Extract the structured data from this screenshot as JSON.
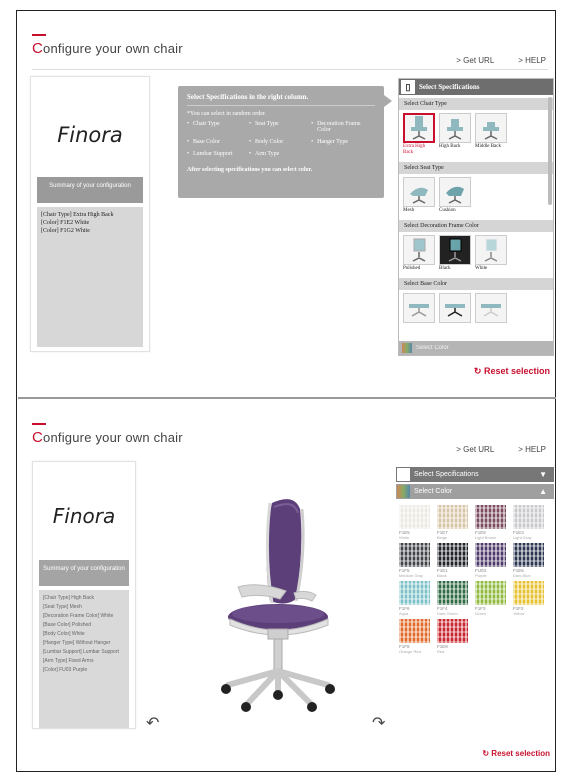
{
  "panel1": {
    "title_cap": "C",
    "title_rest": "onfigure your own chair",
    "links": {
      "get_url": "> Get URL",
      "help": "> HELP"
    },
    "brand": "Finora",
    "summary_header": "Summary of your configuration",
    "summary_lines": [
      "[Chair Type] Extra High Back",
      "[Color] F1E2 White",
      "[Color] F1G2 White"
    ],
    "instructions": {
      "title": "Select Specifications in the right column.",
      "note": "*You can select in random order.",
      "items": [
        "Chair Type",
        "Seat Type",
        "Decoration Frame Color",
        "Base Color",
        "Body Color",
        "Hanger Type",
        "Lumbar Support",
        "Arm Type"
      ],
      "after": "After selecting specifications you can select color."
    },
    "spec_panel": {
      "header": "Select Specifications",
      "sections": [
        {
          "label": "Select Chair Type",
          "options": [
            "Extra High Back",
            "High Back",
            "Middle Back"
          ]
        },
        {
          "label": "Select Seat Type",
          "options": [
            "Mesh",
            "Cushion"
          ]
        },
        {
          "label": "Select Decoration Frame Color",
          "options": [
            "Polished",
            "Black",
            "White"
          ]
        },
        {
          "label": "Select Base Color",
          "options": [
            "",
            "",
            ""
          ]
        }
      ],
      "footer": "Select Color"
    },
    "reset": "Reset selection"
  },
  "panel2": {
    "title_cap": "C",
    "title_rest": "onfigure your own chair",
    "links": {
      "get_url": "> Get URL",
      "help": "> HELP"
    },
    "brand": "Finora",
    "summary_header": "Summary of your configuration",
    "summary_lines": [
      "[Chair Type] High Back",
      "[Seat Type] Mesh",
      "[Decoration Frame Color] White",
      "[Base Color] Polished",
      "[Body Color] White",
      "[Hanger Type] Without Hanger",
      "[Lumbar Support] Lumbar Support",
      "[Arm Type] Fixed Arms",
      "[Color] FU03 Purple"
    ],
    "spec_header": "Select Specifications",
    "color_header": "Select Color",
    "swatches": [
      {
        "code": "F1E5",
        "name": "White",
        "color": "#ece9e2"
      },
      {
        "code": "F1E7",
        "name": "Beige",
        "color": "#d8c6a8"
      },
      {
        "code": "F1E8",
        "name": "Light Brown",
        "color": "#7a4a5e"
      },
      {
        "code": "F1E3",
        "name": "Light Gray",
        "color": "#c9c9cc"
      },
      {
        "code": "F1F5",
        "name": "Medium Gray",
        "color": "#404448"
      },
      {
        "code": "F1E1",
        "name": "Black",
        "color": "#1f2226"
      },
      {
        "code": "FU03",
        "name": "Purple",
        "color": "#4e3a6a"
      },
      {
        "code": "F1E6",
        "name": "Dark Blue",
        "color": "#2b3550"
      },
      {
        "code": "F1F6",
        "name": "Aqua",
        "color": "#7bc1c7"
      },
      {
        "code": "F1F4",
        "name": "Dark Green",
        "color": "#2f6a44"
      },
      {
        "code": "F1F3",
        "name": "Green",
        "color": "#8fba3e"
      },
      {
        "code": "F1F2",
        "name": "Yellow",
        "color": "#e7c230"
      },
      {
        "code": "F1F8",
        "name": "Orange Red",
        "color": "#e06a2a"
      },
      {
        "code": "F1E9",
        "name": "Red",
        "color": "#c8252e"
      }
    ],
    "reset": "Reset selection"
  },
  "colors": {
    "accent": "#c8102e",
    "chair_purple": "#5c3f78"
  }
}
